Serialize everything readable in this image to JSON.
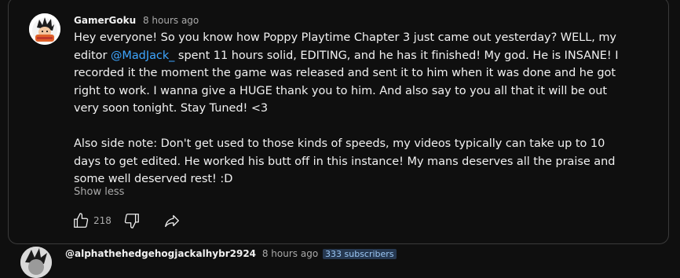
{
  "post": {
    "author": "GamerGoku",
    "time": "8 hours ago",
    "body": {
      "line1_before_mention": "Hey everyone! So you know how Poppy Playtime Chapter 3 just came out yesterday? WELL, my editor ",
      "mention": "@MadJack_",
      "line1_after_mention": " spent 11 hours solid, EDITING, and he has it finished! My god. He is INSANE! I recorded it the moment the game was released and sent it to him when it was done and he got right to work. I wanna give a HUGE thank you to him. And also say to you all that it will be out very soon tonight. Stay Tuned! <3",
      "paragraph2": "Also side note: Don't get used to those kinds of speeds, my videos typically can take up to 10 days to get edited. He worked his butt off in this instance! My mans deserves all the praise and some well deserved rest! :D"
    },
    "show_less_label": "Show less",
    "like_count": "218",
    "icons": {
      "like": "thumbs-up-icon",
      "dislike": "thumbs-down-icon",
      "share": "share-icon"
    }
  },
  "next_comment": {
    "author": "@alphathehedgehogjackalhybr2924",
    "time": "8 hours ago",
    "subscriber_badge": "333 subscribers"
  },
  "colors": {
    "background": "#0f0f0f",
    "text": "#f1f1f1",
    "secondary_text": "#aaaaaa",
    "mention": "#3ea6ff",
    "card_border": "#3a3a3a"
  }
}
